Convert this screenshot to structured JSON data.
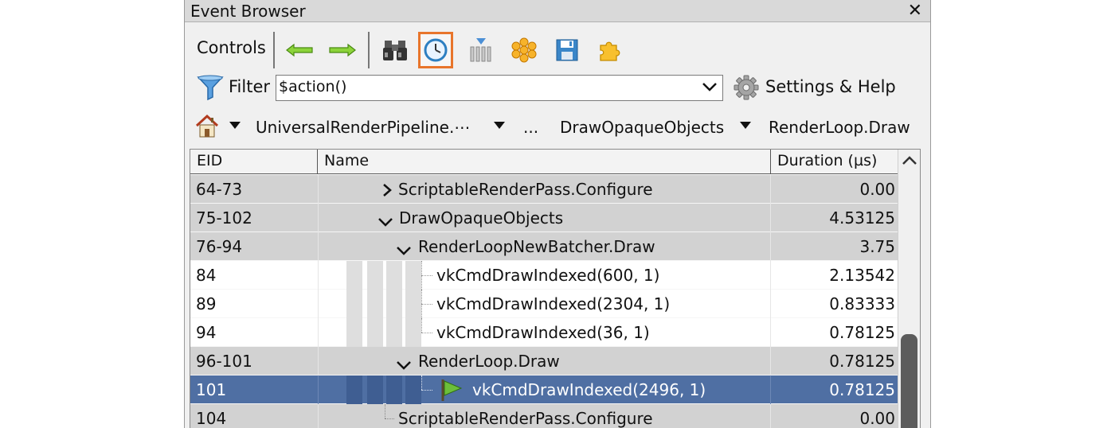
{
  "window": {
    "title": "Event Browser",
    "close_glyph": "✕"
  },
  "toolbar": {
    "controls_label": "Controls",
    "buttons": [
      {
        "icon": "arrow-left-icon"
      },
      {
        "icon": "arrow-right-icon"
      },
      {
        "icon": "binoculars-icon"
      },
      {
        "icon": "clock-icon",
        "active": true
      },
      {
        "icon": "columns-icon"
      },
      {
        "icon": "asterisk-icon"
      },
      {
        "icon": "save-icon"
      },
      {
        "icon": "puzzle-icon"
      }
    ]
  },
  "filter": {
    "label": "Filter",
    "value": "$action()",
    "settings_label": "Settings & Help"
  },
  "breadcrumb": {
    "items": [
      "UniversalRenderPipeline.⋯",
      "...",
      "DrawOpaqueObjects",
      "RenderLoop.Draw"
    ]
  },
  "table": {
    "columns": [
      "EID",
      "Name",
      "Duration (µs)"
    ],
    "rows": [
      {
        "eid": "64-73",
        "name": "ScriptableRenderPass.Configure",
        "duration": "0.00",
        "style": "grey"
      },
      {
        "eid": "75-102",
        "name": "DrawOpaqueObjects",
        "duration": "4.53125",
        "style": "grey"
      },
      {
        "eid": "76-94",
        "name": "RenderLoopNewBatcher.Draw",
        "duration": "3.75",
        "style": "grey"
      },
      {
        "eid": "84",
        "name": "vkCmdDrawIndexed(600, 1)",
        "duration": "2.13542",
        "style": "white"
      },
      {
        "eid": "89",
        "name": "vkCmdDrawIndexed(2304, 1)",
        "duration": "0.83333",
        "style": "white"
      },
      {
        "eid": "94",
        "name": "vkCmdDrawIndexed(36, 1)",
        "duration": "0.78125",
        "style": "white"
      },
      {
        "eid": "96-101",
        "name": "RenderLoop.Draw",
        "duration": "0.78125",
        "style": "grey"
      },
      {
        "eid": "101",
        "name": "vkCmdDrawIndexed(2496, 1)",
        "duration": "0.78125",
        "style": "selected"
      },
      {
        "eid": "104",
        "name": "ScriptableRenderPass.Configure",
        "duration": "0.00",
        "style": "grey"
      }
    ]
  },
  "colors": {
    "accent": "#e8752b",
    "selection": "#4f6fa3",
    "row_grey": "#d2d2d2"
  }
}
